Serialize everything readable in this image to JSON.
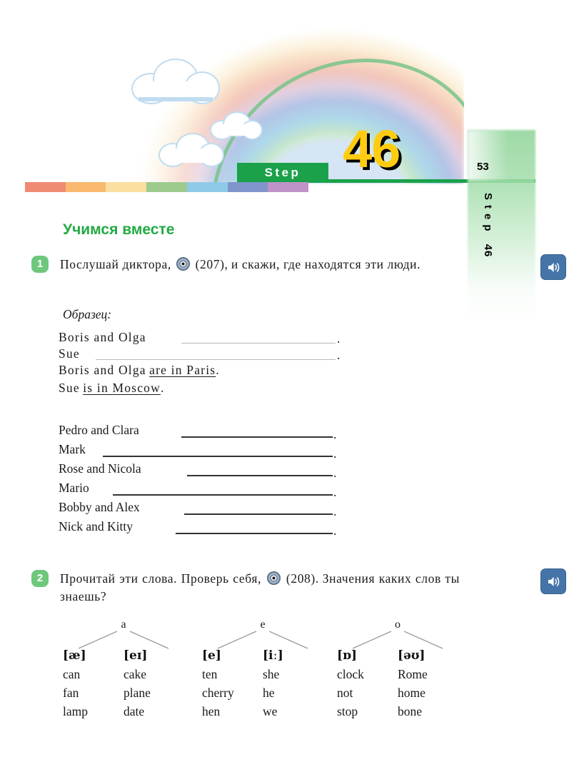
{
  "header": {
    "step_label": "Step",
    "step_number": "46",
    "page_number": "53",
    "vertical_step_word": "Step",
    "vertical_step_number": "46",
    "stripe_colors": [
      "#ef8a72",
      "#f8b96f",
      "#fbdfa0",
      "#9dcb8e",
      "#8fcbe8",
      "#8095cc",
      "#bf92c8"
    ],
    "accent_green": "#1aa14a",
    "number_yellow": "#ffcc11"
  },
  "section_title": "Учимся вместе",
  "exercise1": {
    "number": "1",
    "task_part1": "Послушай диктора,",
    "audio_icon": "cd-icon",
    "track": "(207),",
    "task_part2": "и скажи, где находятся эти люди.",
    "example_label": "Образец:",
    "example_blank_lines": [
      {
        "name": "Boris and Olga",
        "filled": false
      },
      {
        "name": "Sue",
        "filled": false
      }
    ],
    "example_answers": [
      {
        "name": "Boris and Olga",
        "answer": "are in Paris",
        "end": "."
      },
      {
        "name": "Sue",
        "answer": "is in Moscow",
        "end": "."
      }
    ],
    "items": [
      {
        "name": "Pedro and Clara",
        "end": "."
      },
      {
        "name": "Mark",
        "end": "."
      },
      {
        "name": "Rose and Nicola",
        "end": "."
      },
      {
        "name": "Mario",
        "end": "."
      },
      {
        "name": "Bobby and Alex",
        "end": "."
      },
      {
        "name": "Nick and Kitty",
        "end": "."
      }
    ]
  },
  "exercise2": {
    "number": "2",
    "task_part1": "Прочитай эти слова. Проверь себя,",
    "audio_icon": "cd-icon",
    "track": "(208).",
    "task_part2": "Значения каких слов ты знаешь?",
    "groups": [
      {
        "letter": "a",
        "columns": [
          {
            "ipa": "[æ]",
            "words": [
              "can",
              "fan",
              "lamp"
            ]
          },
          {
            "ipa": "[eɪ]",
            "words": [
              "cake",
              "plane",
              "date"
            ]
          }
        ]
      },
      {
        "letter": "e",
        "columns": [
          {
            "ipa": "[e]",
            "words": [
              "ten",
              "cherry",
              "hen"
            ]
          },
          {
            "ipa": "[iː]",
            "words": [
              "she",
              "he",
              "we"
            ]
          }
        ]
      },
      {
        "letter": "o",
        "columns": [
          {
            "ipa": "[ɒ]",
            "words": [
              "clock",
              "not",
              "stop"
            ]
          },
          {
            "ipa": "[əʊ]",
            "words": [
              "Rome",
              "home",
              "bone"
            ]
          }
        ]
      }
    ]
  },
  "audio_buttons": [
    {
      "name": "speaker-icon",
      "color": "#4575a8"
    },
    {
      "name": "speaker-icon",
      "color": "#4575a8"
    }
  ]
}
